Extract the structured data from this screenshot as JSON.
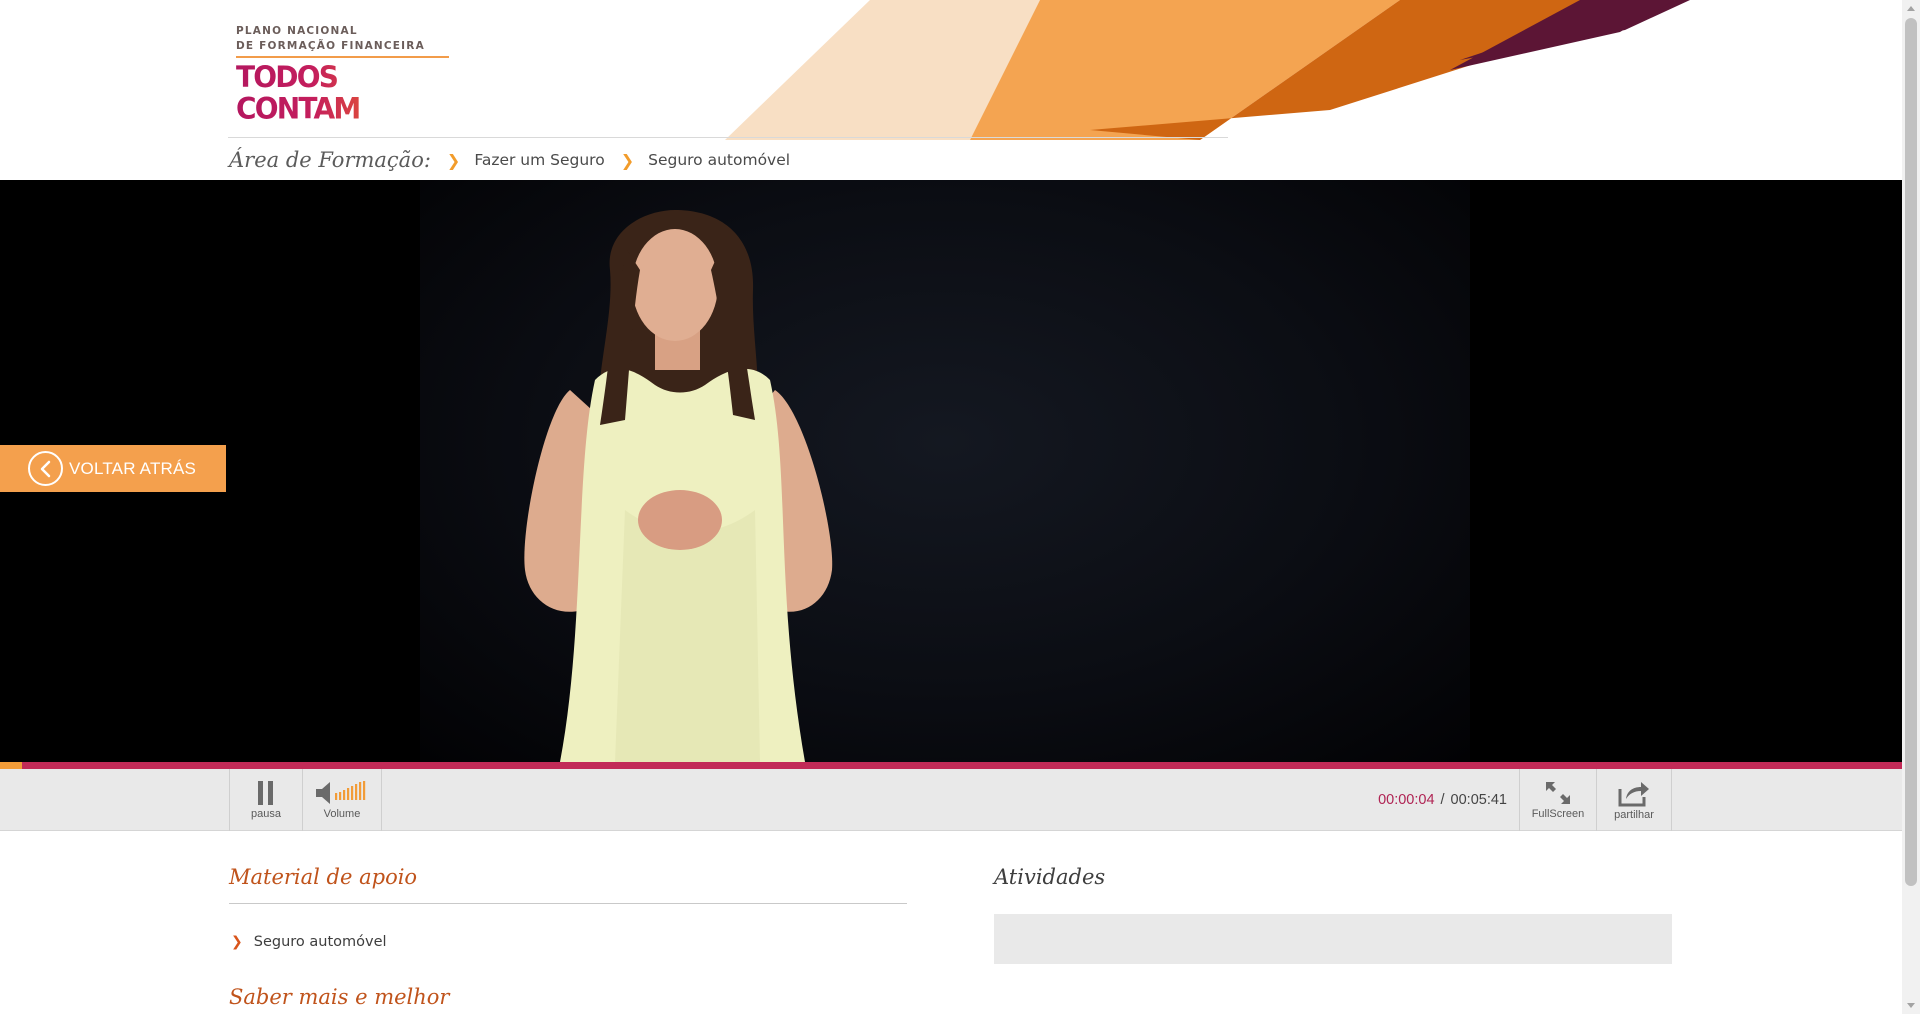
{
  "header": {
    "logo": {
      "line1": "PLANO NACIONAL",
      "line2": "DE FORMAÇÃO FINANCEIRA",
      "wordmark": "TODOS CONTAM"
    },
    "colors": {
      "peach": "#f8dfc4",
      "orange": "#f4a451",
      "dark_orange": "#cf6612",
      "plum": "#5c1535"
    }
  },
  "breadcrumb": {
    "title": "Área de Formação:",
    "items": [
      "Fazer um Seguro",
      "Seguro automóvel"
    ]
  },
  "video": {
    "back_button_label": "VOLTAR ATRÁS",
    "progress_fraction": 0.0117
  },
  "controls": {
    "pause_label": "pausa",
    "volume_label": "Volume",
    "fullscreen_label": "FullScreen",
    "share_label": "partilhar",
    "time_current": "00:00:04",
    "time_separator": "/",
    "time_total": "00:05:41"
  },
  "content": {
    "material_heading": "Material de apoio",
    "material_items": [
      "Seguro automóvel"
    ],
    "saber_heading": "Saber mais e melhor",
    "atividades_heading": "Atividades"
  },
  "theme": {
    "accent_orange": "#f4a04d",
    "progress_red": "#c22a57",
    "heading_orange": "#c0531b"
  }
}
